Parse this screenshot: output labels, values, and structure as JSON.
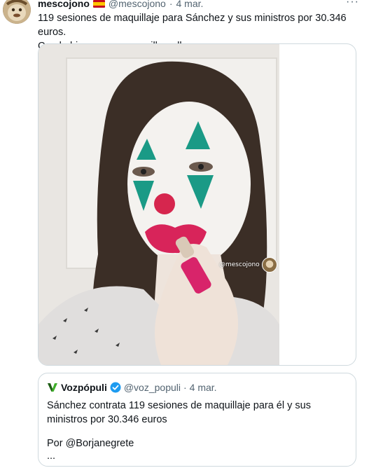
{
  "tweet": {
    "author_name": "mescojono",
    "author_handle": "@mescojono",
    "separator": "·",
    "date": "4 mar.",
    "more": "···",
    "text_line1": "119 sesiones de maquillaje para Sánchez y sus ministros por 30.346 euros.",
    "text_line2": "Con lo bien que se maquillan ellos en casa."
  },
  "media": {
    "watermark": "@mescojono"
  },
  "quoted_tweet": {
    "author_name": "Vozpópuli",
    "author_handle": "@voz_populi",
    "separator": "·",
    "date": "4 mar.",
    "text": "Sánchez contrata 119 sesiones de maquillaje para él y sus ministros por 30.346 euros",
    "byline": "Por @Borjanegrete",
    "ellipsis": "..."
  },
  "colors": {
    "verified_blue": "#1d9bf0",
    "vozpopuli_green": "#3fae2a",
    "secondary_text": "#536471"
  },
  "icons": [
    "spain-flag-icon",
    "more-options-icon",
    "vozpopuli-logo-icon",
    "verified-badge-icon"
  ]
}
